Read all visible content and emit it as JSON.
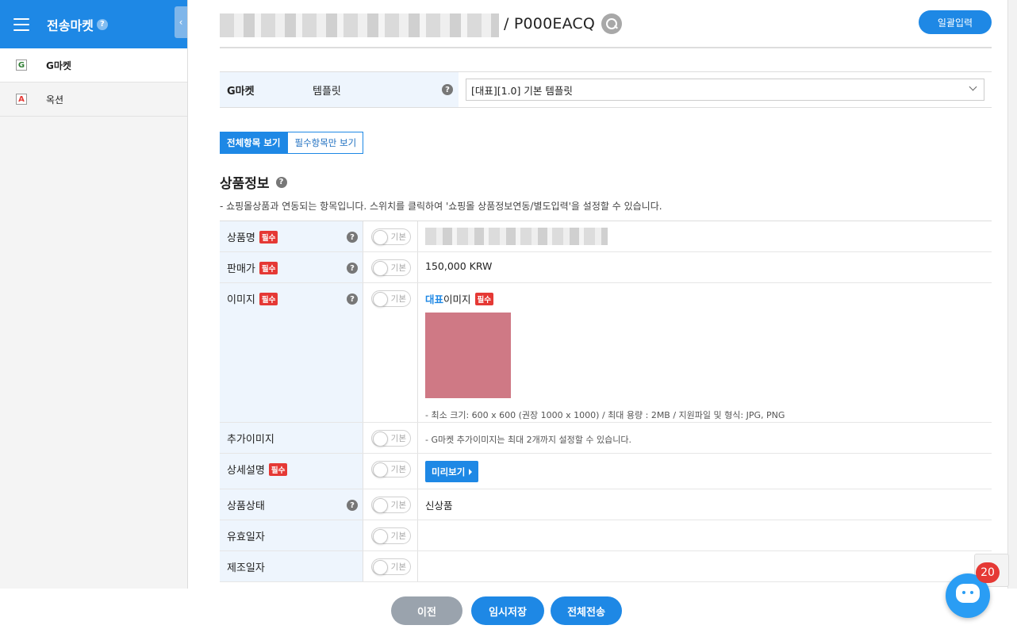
{
  "sidebar": {
    "title": "전송마켓",
    "help": "?",
    "collapse": "‹",
    "items": [
      {
        "icon_letter": "G",
        "icon": "gmarket-icon",
        "label": "G마켓"
      },
      {
        "icon_letter": "A",
        "icon": "auction-icon",
        "label": "옥션"
      }
    ]
  },
  "header": {
    "product_code": "/ P000EACQ",
    "bulk_button": "일괄입력"
  },
  "template": {
    "market": "G마켓",
    "label": "템플릿",
    "help": "?",
    "selected": "[대표][1.0] 기본 템플릿"
  },
  "view_toggle": {
    "all": "전체항목 보기",
    "required": "필수항목만 보기"
  },
  "section": {
    "title": "상품정보",
    "help": "?",
    "description": "- 쇼핑몰상품과 연동되는 항목입니다. 스위치를 클릭하여 '쇼핑몰 상품정보연동/별도입력'을 설정할 수 있습니다."
  },
  "toggle_label": "기본",
  "required_badge": "필수",
  "fields": {
    "name": {
      "label": "상품명"
    },
    "price": {
      "label": "판매가",
      "value": "150,000 KRW"
    },
    "image": {
      "label": "이미지",
      "main_prefix": "대표",
      "main_suffix": "이미지",
      "note": "- 최소 크기: 600 x 600 (권장 1000 x 1000) / 최대 용량 : 2MB / 지원파일 및 형식: JPG, PNG"
    },
    "extra_image": {
      "label": "추가이미지",
      "note": "- G마켓 추가이미지는 최대 2개까지 설정할 수 있습니다."
    },
    "detail": {
      "label": "상세설명",
      "preview": "미리보기"
    },
    "condition": {
      "label": "상품상태",
      "value": "신상품"
    },
    "expiry": {
      "label": "유효일자"
    },
    "manufacture": {
      "label": "제조일자"
    }
  },
  "footer": {
    "prev": "이전",
    "save_draft": "임시저장",
    "send_all": "전체전송"
  },
  "chat": {
    "badge": "20"
  },
  "colors": {
    "primary": "#1e88e5",
    "required": "#e53935",
    "label_bg": "#eef5fd"
  }
}
